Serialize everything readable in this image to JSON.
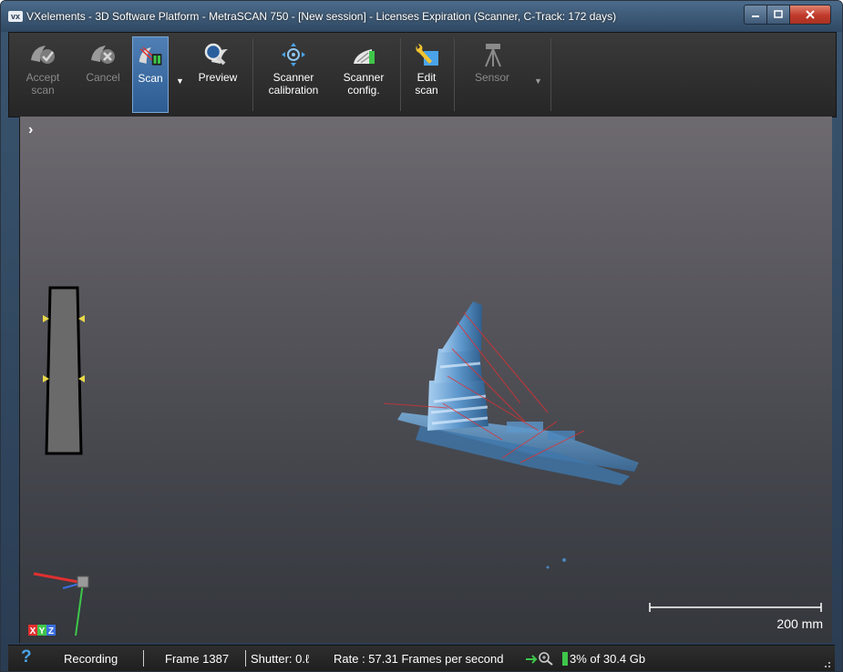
{
  "window": {
    "title": "VXelements - 3D Software Platform - MetraSCAN 750 - [New session] - Licenses Expiration (Scanner, C-Track: 172 days)",
    "app_icon_text": "vx"
  },
  "toolbar": {
    "accept_scan": "Accept\nscan",
    "cancel": "Cancel",
    "scan": "Scan",
    "preview": "Preview",
    "scanner_calibration": "Scanner\ncalibration",
    "scanner_config": "Scanner\nconfig.",
    "edit_scan": "Edit\nscan",
    "sensor": "Sensor"
  },
  "viewport": {
    "expand_glyph": "›",
    "axis_labels": [
      "X",
      "Y",
      "Z"
    ],
    "scale_label": "200 mm"
  },
  "statusbar": {
    "help_glyph": "?",
    "recording": "Recording",
    "frame": "Frame 1387",
    "shutter": "Shutter: 0.ℓ",
    "rate": "Rate : 57.31 Frames per second",
    "memory": "3% of 30.4 Gb"
  },
  "colors": {
    "scan_blue": "#6aa3d6",
    "highlight_blue": "#4f7fb4",
    "axis_x": "#e03030",
    "axis_y": "#3ec64a",
    "axis_z": "#3a6fe0",
    "memory_green": "#3ec64a"
  },
  "icons": {
    "accept_scan": "accept-check-icon",
    "cancel": "cancel-x-icon",
    "scan": "scan-icon",
    "preview": "magnifier-icon",
    "scanner_calibration": "calibration-target-icon",
    "scanner_config": "scanner-config-icon",
    "edit_scan": "edit-wrench-icon",
    "sensor": "tripod-sensor-icon"
  }
}
